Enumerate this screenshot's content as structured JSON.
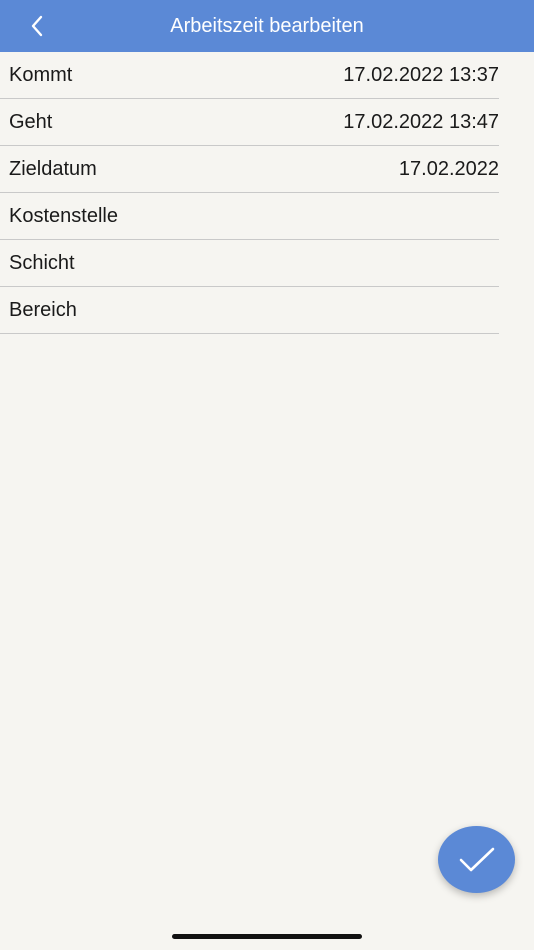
{
  "header": {
    "title": "Arbeitszeit bearbeiten",
    "back_icon": "chevron-left-icon"
  },
  "rows": [
    {
      "label": "Kommt",
      "value": "17.02.2022 13:37"
    },
    {
      "label": "Geht",
      "value": "17.02.2022 13:47"
    },
    {
      "label": "Zieldatum",
      "value": "17.02.2022"
    },
    {
      "label": "Kostenstelle",
      "value": ""
    },
    {
      "label": "Schicht",
      "value": ""
    },
    {
      "label": "Bereich",
      "value": ""
    }
  ],
  "fab": {
    "icon": "checkmark-icon"
  },
  "colors": {
    "accent": "#5b89d6",
    "background": "#f6f5f1",
    "divider": "#c9c9c9",
    "text": "#1a1a1a"
  }
}
